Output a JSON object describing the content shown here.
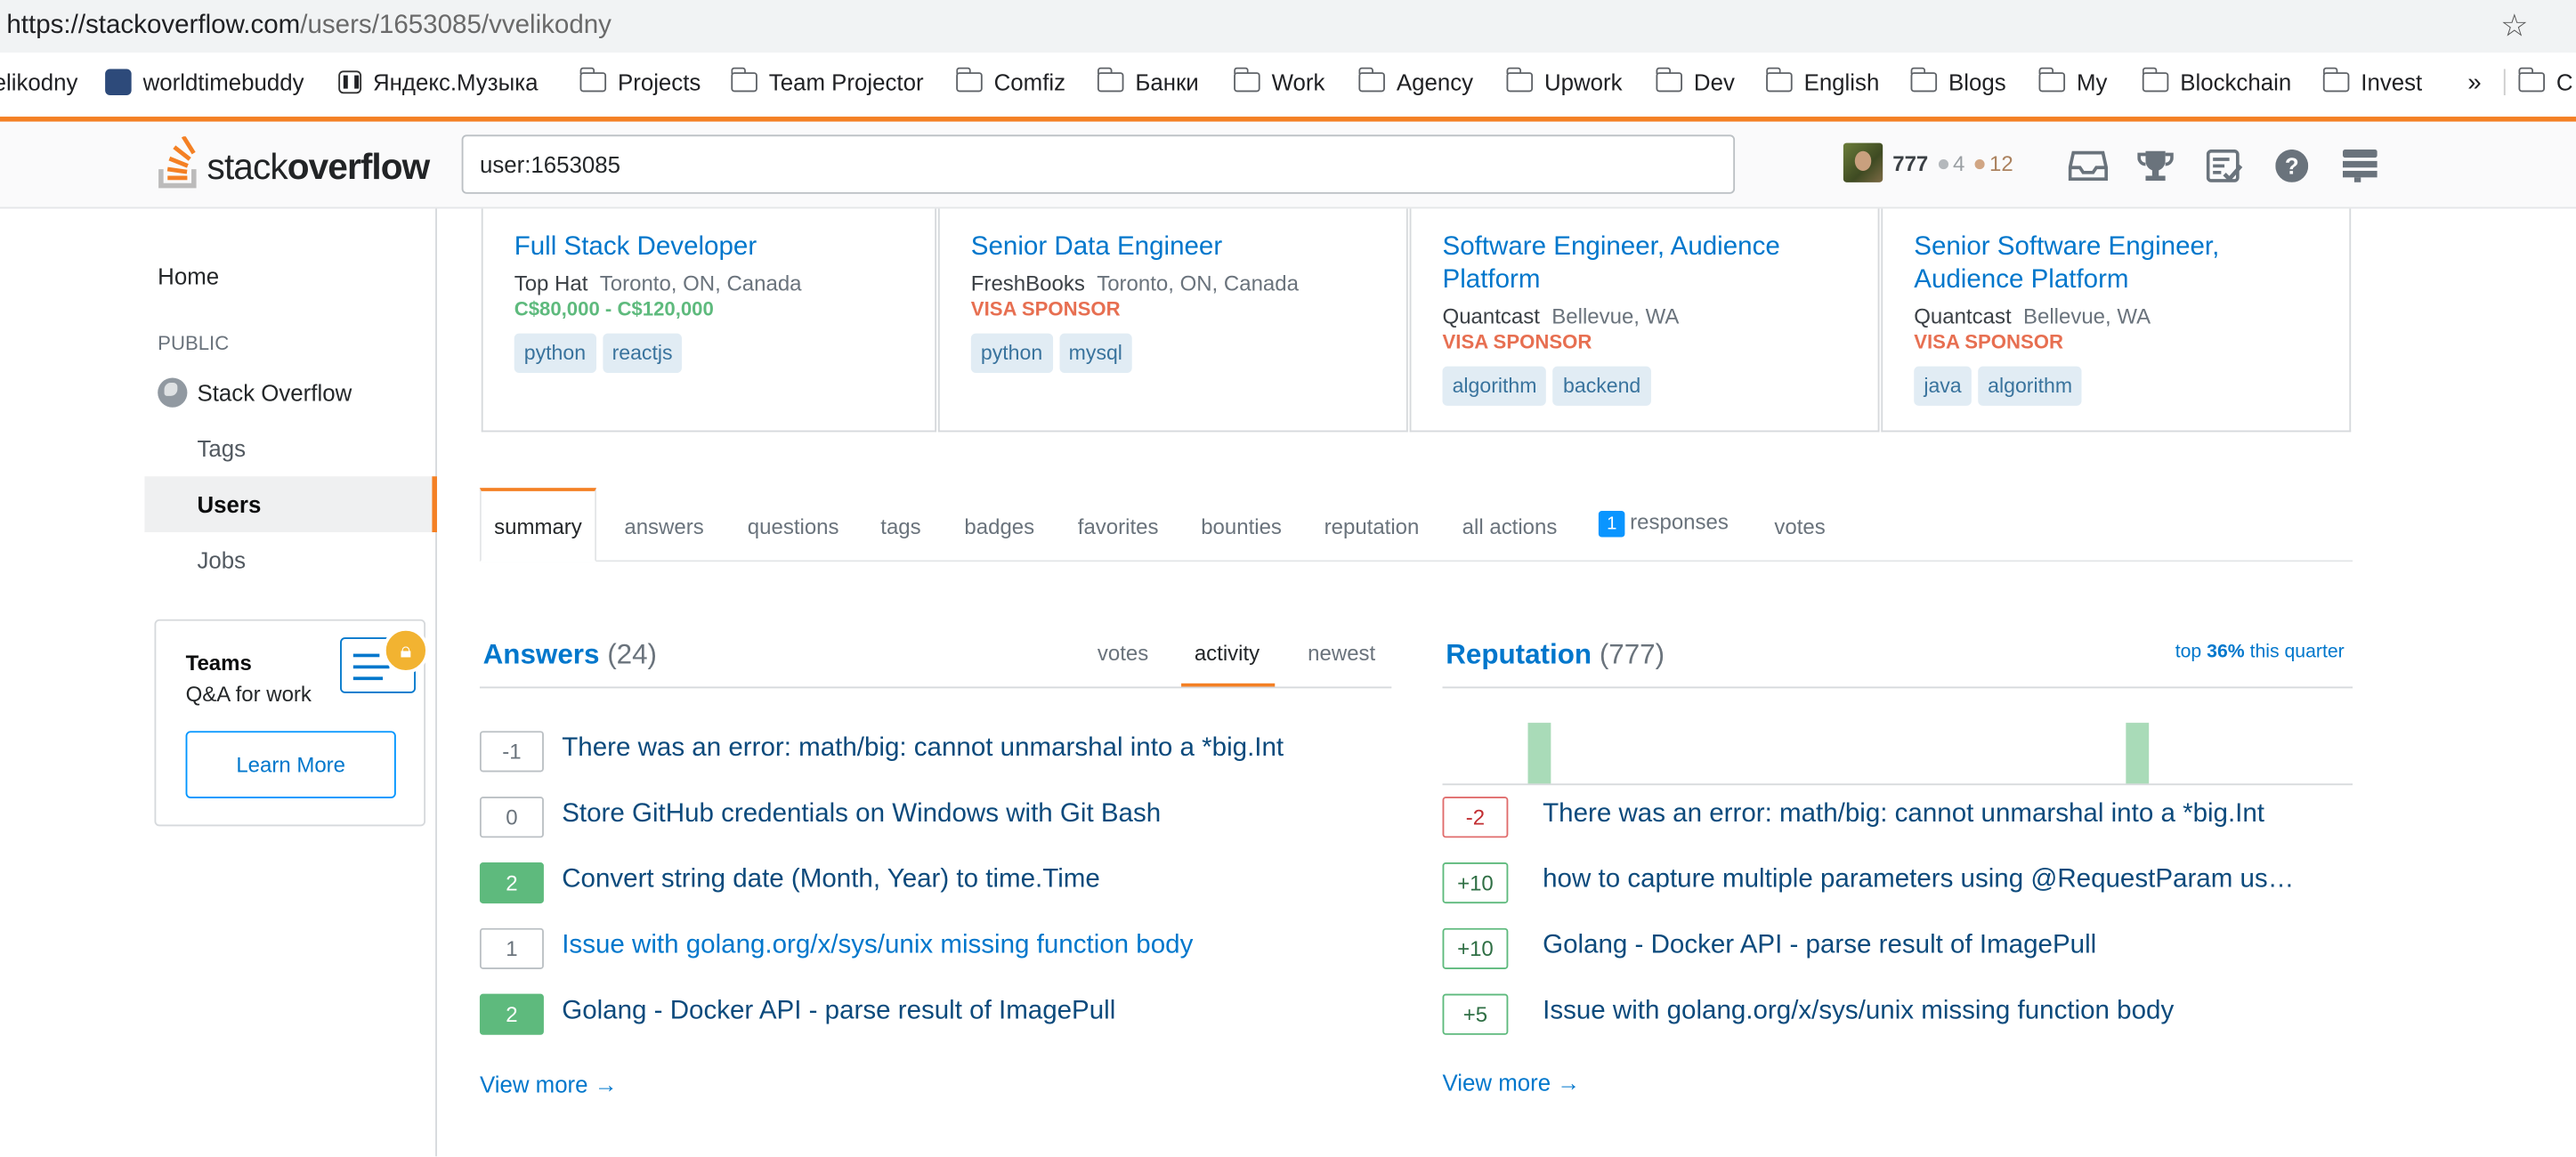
{
  "browser": {
    "url_domain": "https://stackoverflow.com",
    "url_path": "/users/1653085/vvelikodny",
    "bookmarks": [
      "elikodny",
      "worldtimebuddy",
      "Яндекс.Музыка",
      "Projects",
      "Team Projector",
      "Comfiz",
      "Банки",
      "Work",
      "Agency",
      "Upwork",
      "Dev",
      "English",
      "Blogs",
      "My",
      "Blockchain",
      "Invest"
    ],
    "overflow_label": "»",
    "cut_label": "C"
  },
  "topbar": {
    "logo_light": "stack",
    "logo_bold": "overflow",
    "search_value": "user:1653085",
    "reputation": "777",
    "silver_badges": "4",
    "bronze_badges": "12"
  },
  "sidebar": {
    "home": "Home",
    "public": "PUBLIC",
    "stack_overflow": "Stack Overflow",
    "tags": "Tags",
    "users": "Users",
    "jobs": "Jobs",
    "teams_title": "Teams",
    "teams_sub": "Q&A for work",
    "learn_more": "Learn More"
  },
  "jobs": [
    {
      "title": "Full Stack Developer",
      "company": "Top Hat",
      "location": "Toronto, ON, Canada",
      "salary": "C$80,000 - C$120,000",
      "visa": "",
      "tags": [
        "python",
        "reactjs"
      ]
    },
    {
      "title": "Senior Data Engineer",
      "company": "FreshBooks",
      "location": "Toronto, ON, Canada",
      "salary": "",
      "visa": "VISA SPONSOR",
      "tags": [
        "python",
        "mysql"
      ]
    },
    {
      "title": "Software Engineer, Audience Platform",
      "company": "Quantcast",
      "location": "Bellevue, WA",
      "salary": "",
      "visa": "VISA SPONSOR",
      "tags": [
        "algorithm",
        "backend"
      ]
    },
    {
      "title": "Senior Software Engineer, Audience Platform",
      "company": "Quantcast",
      "location": "Bellevue, WA",
      "salary": "",
      "visa": "VISA SPONSOR",
      "tags": [
        "java",
        "algorithm"
      ]
    }
  ],
  "tabs": {
    "summary": "summary",
    "answers": "answers",
    "questions": "questions",
    "tags": "tags",
    "badges": "badges",
    "favorites": "favorites",
    "bounties": "bounties",
    "reputation": "reputation",
    "all_actions": "all actions",
    "responses_count": "1",
    "responses": "responses",
    "votes": "votes"
  },
  "answers": {
    "heading": "Answers",
    "count": "(24)",
    "sort_votes": "votes",
    "sort_activity": "activity",
    "sort_newest": "newest",
    "items": [
      {
        "score": "-1",
        "title": "There was an error: math/big: cannot unmarshal into a *big.Int"
      },
      {
        "score": "0",
        "title": "Store GitHub credentials on Windows with Git Bash"
      },
      {
        "score": "2",
        "title": "Convert string date (Month, Year) to time.Time"
      },
      {
        "score": "1",
        "title": "Issue with golang.org/x/sys/unix missing function body"
      },
      {
        "score": "2",
        "title": "Golang - Docker API - parse result of ImagePull"
      }
    ],
    "view_more": "View more →"
  },
  "reputation": {
    "heading": "Reputation",
    "count": "(777)",
    "top_prefix": "top",
    "top_pct": "36%",
    "top_suffix": "this quarter",
    "items": [
      {
        "delta": "-2",
        "title": "There was an error: math/big: cannot unmarshal into a *big.Int"
      },
      {
        "delta": "+10",
        "title": "how to capture multiple parameters using @RequestParam using spring mvc?"
      },
      {
        "delta": "+10",
        "title": "Golang - Docker API - parse result of ImagePull"
      },
      {
        "delta": "+5",
        "title": "Issue with golang.org/x/sys/unix missing function body"
      }
    ],
    "view_more": "View more →"
  },
  "colors": {
    "accent": "#f48024",
    "link": "#0077cc",
    "accepted": "#5eba7d",
    "visa": "#e76f51"
  }
}
